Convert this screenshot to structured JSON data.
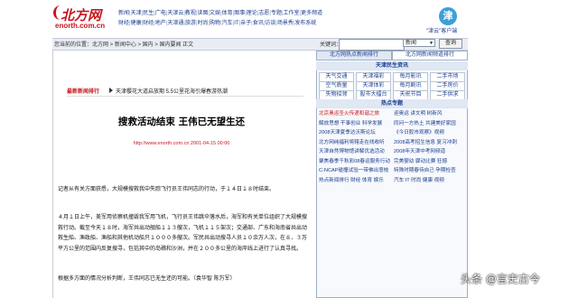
{
  "header": {
    "logo_text": "北方网",
    "logo_url": "enorth.com.cn",
    "nav_rows": [
      [
        "新闻",
        "天津",
        "民生",
        "广电",
        "天津云",
        "教视",
        "读图",
        "文娱",
        "体育",
        "图事",
        "理论",
        "志愿",
        "专题",
        "工作室",
        "更多频道"
      ],
      [
        "财经",
        "健康",
        "财经",
        "地产",
        "天津通",
        "旅游",
        "时尚",
        "购物",
        "汽车",
        "IT",
        "亲子",
        "食讯",
        "访谈",
        "场景秀",
        "发布系统"
      ]
    ],
    "mascot_glyph": "津",
    "mascot_label": "\"津云\"客户端"
  },
  "breadcrumb": {
    "text": "您当前的位置：北方网 > 新闻中心 > 国内 > 国内要闻 正文",
    "keyword_label": "关键词：",
    "search_input_value": "",
    "select_value": "新闻",
    "search_button": "查询"
  },
  "right_tabs": [
    "北方网热点新闻排行",
    "北方网新闻频道排行"
  ],
  "article": {
    "latest_label": "最新新闻排行",
    "latest_item": "天津樱花大道启放期 5.5公里花海引爆春游热潮",
    "title": "搜救活动结束 王伟已无望生还",
    "meta": "http://www.enorth.com.cn    2001-04-15 00:00",
    "paragraphs": [
      "记者从有关方面获悉，大规模搜救我中失踪飞行员王伟同志的行动，于１４日１８时结束。",
      "４月１日上午，美军用侦察机撞毁我军用飞机，飞行员王伟跳伞落水后，海军和有关单位组织了大规模搜救行动。截至今天１８时，海军共出动舰船１１３艘次，飞机１１５架次；交通部、广东和海南省共出动救生船、渔政船、渔船和其他机动船只１０００多艘次。军民共出动搜寻人员１０余万人次，在８．３万平方公里的范围内反复搜寻，包括其中的岛礁和沙洲，并在２００多公里的海岸线上进行了认真寻找。",
      "根据多方面的情况分析判断，王伟同志已无生还的可能。（袁华智 陈万军）"
    ]
  },
  "weather": {
    "title": "天津民生资讯",
    "cells": [
      [
        "天气交通",
        "天津福彩",
        "每月影讯",
        "二手市场"
      ],
      [
        "空气质量",
        "天津体彩",
        "每月剧讯",
        "二手房价"
      ],
      [
        "失物招领",
        "股市大擂台",
        "天祝节目",
        "二手供求"
      ]
    ]
  },
  "hot": {
    "title": "热点专题",
    "rows": [
      [
        "北京奥运圣火传递和谐之旅",
        "迎奥运 讲文明 树新风"
      ],
      [
        "解放思想 干事创业 科学发展",
        "同问一方热土 共建美好家园"
      ],
      [
        "2008天津夏季达沃斯论坛",
        "《今日股市观察》视频"
      ],
      [
        "北方网纯福利将辖走在线收听",
        "2008高考招生信息 复习冲刺"
      ],
      [
        "天津自然博物馆讲解优选活动",
        "2008年天津中考网频道"
      ],
      [
        "聚焦春季千秋彩08春运服务行动",
        "完美婴幼 骤动比赛 狂撼"
      ],
      [
        "C-NCAP碰撞试验一带佛出意枝",
        "特殊时期春待自己 孕期检查"
      ],
      [
        "热点新闻排行 财经 体育 娱乐",
        "汽车 IT 时尚 健康 视频"
      ]
    ]
  },
  "watermark": "头条 @言史古今"
}
